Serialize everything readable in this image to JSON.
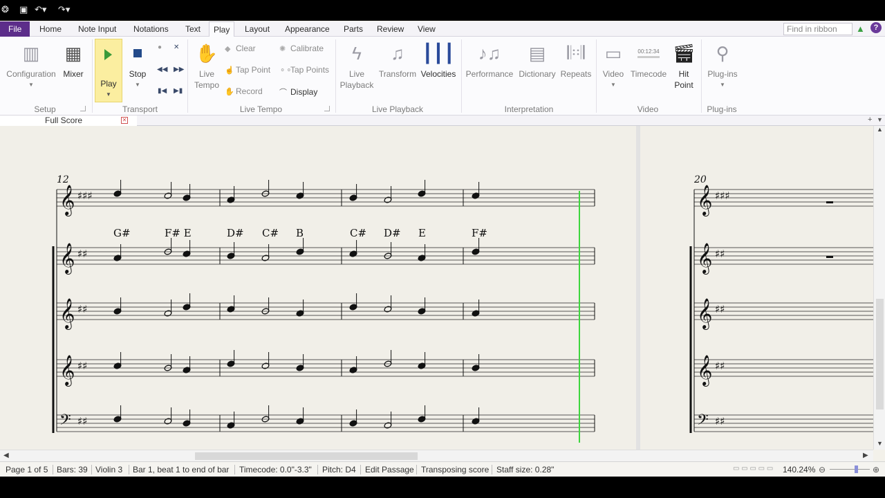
{
  "tabs": [
    "File",
    "Home",
    "Note Input",
    "Notations",
    "Text",
    "Play",
    "Layout",
    "Appearance",
    "Parts",
    "Review",
    "View"
  ],
  "search_placeholder": "Find in ribbon",
  "ribbon": {
    "setup": {
      "label": "Setup",
      "configuration": "Configuration",
      "mixer": "Mixer"
    },
    "transport": {
      "label": "Transport",
      "play": "Play",
      "stop": "Stop"
    },
    "live_tempo": {
      "label": "Live Tempo",
      "live_tempo_btn": "Live Tempo",
      "clear": "Clear",
      "tap_point": "Tap Point",
      "record": "Record",
      "calibrate": "Calibrate",
      "tap_points": "Tap Points",
      "display": "Display"
    },
    "live_playback": {
      "label": "Live Playback",
      "live_playback_btn": "Live Playback",
      "transform": "Transform",
      "velocities": "Velocities"
    },
    "interpretation": {
      "label": "Interpretation",
      "performance": "Performance",
      "dictionary": "Dictionary",
      "repeats": "Repeats"
    },
    "video": {
      "label": "Video",
      "video_btn": "Video",
      "timecode": "Timecode",
      "timecode_readout": "00:12:34",
      "hit_point": "Hit Point"
    },
    "plugins": {
      "label": "Plug-ins",
      "plugins_btn": "Plug-ins"
    }
  },
  "document_tab": "Full Score",
  "score": {
    "bar_numbers": [
      "12",
      "20"
    ],
    "chord_symbols": [
      "G#",
      "F# E",
      "D#",
      "C#",
      "B",
      "C#",
      "D#",
      "E",
      "F#"
    ]
  },
  "status": {
    "page": "Page 1 of 5",
    "bars": "Bars: 39",
    "instrument": "Violin 3",
    "selection": "Bar 1, beat 1 to end of bar",
    "timecode": "Timecode: 0.0\"-3.3\"",
    "pitch": "Pitch: D4",
    "mode": "Edit Passage",
    "transposing": "Transposing score",
    "staff_size": "Staff size: 0.28\"",
    "zoom": "140.24%"
  },
  "colors": {
    "file_tab": "#5c2d8a",
    "playback_line": "#3dd63d",
    "play_highlight": "#fbeea0"
  }
}
